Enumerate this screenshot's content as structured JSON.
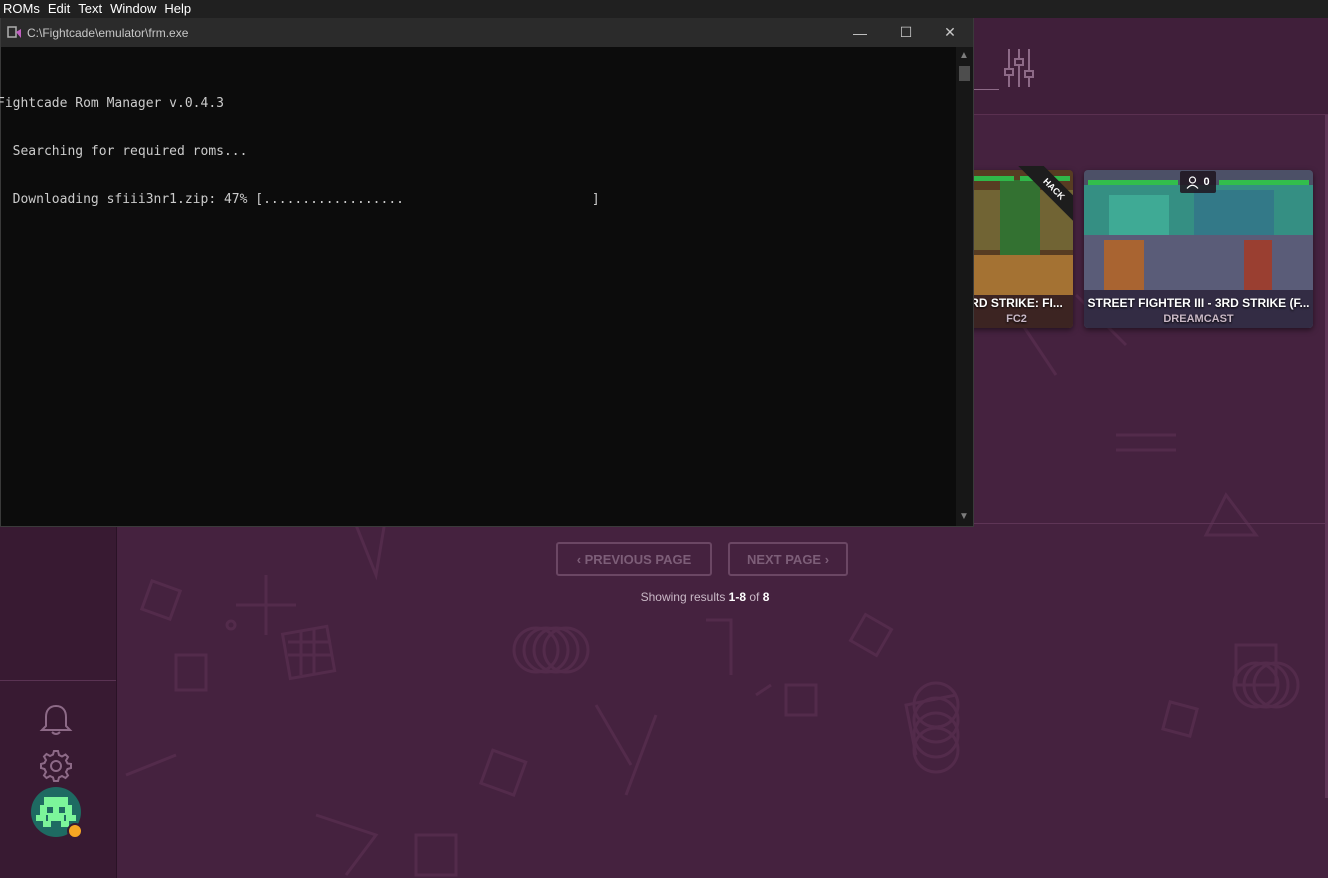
{
  "menubar": {
    "items": [
      "ROMs",
      "Edit",
      "Text",
      "Window",
      "Help"
    ]
  },
  "console": {
    "title": "C:\\Fightcade\\emulator\\frm.exe",
    "lines": [
      "Fightcade Rom Manager v.0.4.3",
      "  Searching for required roms...",
      "  Downloading sfiii3nr1.zip: 47% [..................                        ]"
    ],
    "minimize_glyph": "—",
    "maximize_glyph": "☐",
    "close_glyph": "✕",
    "download_progress": 0.47
  },
  "cards": [
    {
      "title": "RD STRIKE: FI...",
      "subtitle": "FC2",
      "badge": "HACK"
    },
    {
      "title": "STREET FIGHTER III - 3RD STRIKE (F...",
      "subtitle": "DREAMCAST",
      "players": "0"
    }
  ],
  "pagination": {
    "prev_label": "‹ PREVIOUS PAGE",
    "next_label": "NEXT PAGE ›",
    "results_prefix": "Showing results ",
    "results_range": "1-8",
    "results_of": " of ",
    "results_total": "8"
  },
  "sidebar": {
    "icons": [
      "bell-icon",
      "gear-icon",
      "avatar"
    ]
  },
  "colors": {
    "background": "#45223f",
    "sidebar": "#381a32",
    "console_bg": "#0c0c0c",
    "status_dot": "#f5a623"
  }
}
